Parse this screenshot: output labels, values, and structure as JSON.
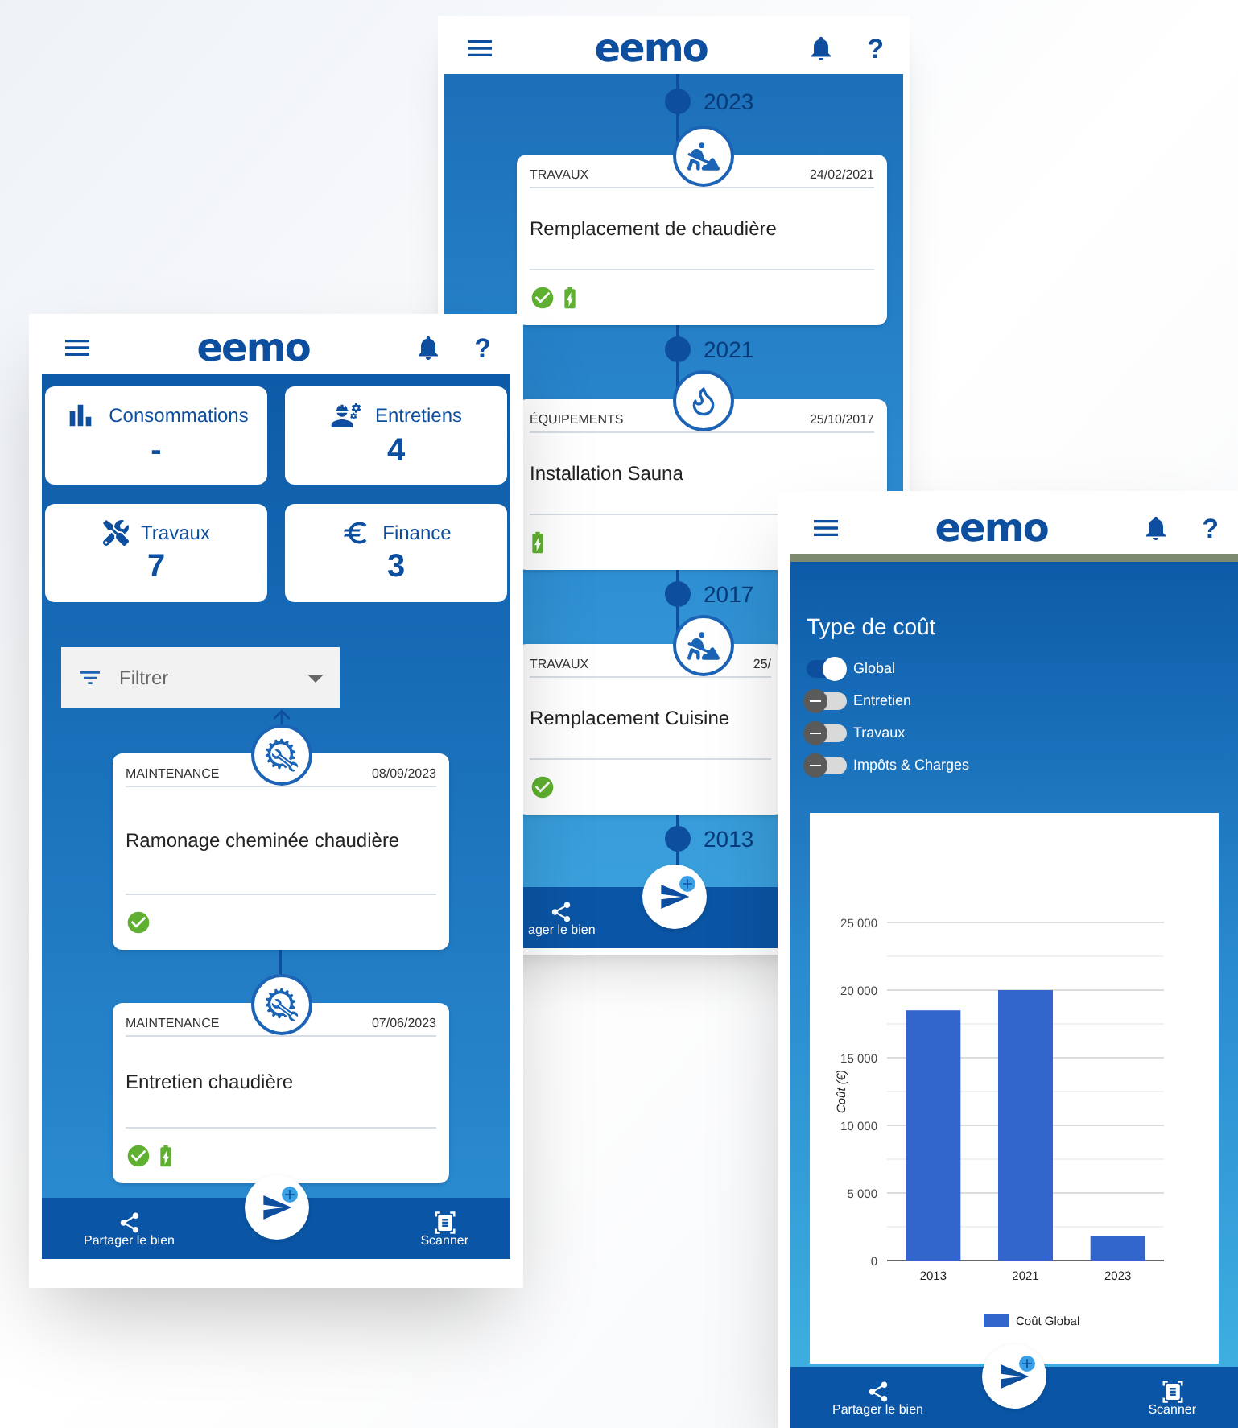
{
  "timeline_phone": {
    "header": {
      "logo": "eemo",
      "help": "?"
    },
    "timeline": [
      {
        "kind": "year",
        "label": "2023"
      },
      {
        "kind": "travaux",
        "category": "TRAVAUX",
        "date": "24/02/2021",
        "title": "Remplacement de chaudière",
        "statuses": [
          {
            "kind": "done"
          },
          {
            "kind": "battery"
          }
        ]
      },
      {
        "kind": "year",
        "label": "2021"
      },
      {
        "kind": "equipement",
        "category": "ÉQUIPEMENTS",
        "date": "25/10/2017",
        "title": "Installation Sauna",
        "statuses": [
          {
            "kind": "battery"
          }
        ]
      },
      {
        "kind": "year",
        "label": "2017"
      },
      {
        "kind": "travaux",
        "category": "TRAVAUX",
        "date": "25/",
        "title": "Remplacement Cuisine",
        "statuses": [
          {
            "kind": "done"
          }
        ]
      },
      {
        "kind": "year",
        "label": "2013"
      }
    ],
    "bottom_bar": {
      "share_label": "ager le bien"
    }
  },
  "dashboard_phone": {
    "header": {
      "logo": "eemo",
      "help": "?"
    },
    "tiles": [
      {
        "label": "Consommations",
        "value": "-"
      },
      {
        "label": "Entretiens",
        "value": "4"
      },
      {
        "label": "Travaux",
        "value": "7"
      },
      {
        "label": "Finance",
        "value": "3"
      }
    ],
    "filter": {
      "placeholder": "Filtrer"
    },
    "timeline": [
      {
        "kind": "maintenance",
        "category": "MAINTENANCE",
        "date": "08/09/2023",
        "title": "Ramonage cheminée chaudière",
        "statuses": [
          {
            "kind": "done"
          }
        ]
      },
      {
        "kind": "maintenance",
        "category": "MAINTENANCE",
        "date": "07/06/2023",
        "title": "Entretien chaudière",
        "statuses": [
          {
            "kind": "done"
          },
          {
            "kind": "battery"
          }
        ]
      }
    ],
    "bottom_bar": {
      "share_label": "Partager le bien",
      "scanner_label": "Scanner"
    }
  },
  "cost_phone": {
    "header": {
      "logo": "eemo",
      "help": "?"
    },
    "title": "Type de coût",
    "filters": [
      {
        "label": "Global",
        "on": true
      },
      {
        "label": "Entretien",
        "on": false
      },
      {
        "label": "Travaux",
        "on": false
      },
      {
        "label": "Impôts & Charges",
        "on": false
      }
    ],
    "chart_data": {
      "type": "bar",
      "grid": true,
      "ylabel": "Coût (€)",
      "categories": [
        "2013",
        "2021",
        "2023"
      ],
      "series": [
        {
          "name": "Coût Global",
          "color": "#3366cc",
          "values": [
            18500,
            20000,
            1800
          ]
        }
      ],
      "ylim": [
        0,
        25000
      ],
      "yticks": [
        {
          "value": 0,
          "label": "0"
        },
        {
          "value": 5000,
          "label": "5 000"
        },
        {
          "value": 10000,
          "label": "10 000"
        },
        {
          "value": 15000,
          "label": "15 000"
        },
        {
          "value": 20000,
          "label": "20 000"
        },
        {
          "value": 25000,
          "label": "25 000"
        }
      ]
    },
    "bottom_bar": {
      "share_label": "Partager le bien",
      "scanner_label": "Scanner"
    }
  }
}
